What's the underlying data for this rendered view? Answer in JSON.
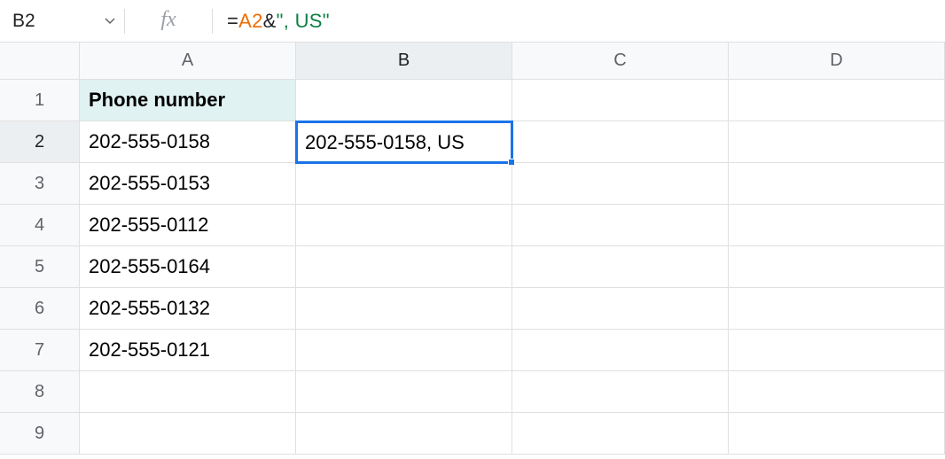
{
  "nameBox": {
    "value": "B2"
  },
  "fxLabel": "fx",
  "formula": {
    "raw": "=A2&\", US\"",
    "tokens": {
      "eq": "=",
      "ref": "A2",
      "op": "&",
      "q1": "\"",
      "str": ", US",
      "q2": "\""
    }
  },
  "columns": [
    "A",
    "B",
    "C",
    "D"
  ],
  "rowCount": 9,
  "activeCell": {
    "col": "B",
    "row": 2
  },
  "cells": {
    "A1": "Phone number",
    "A2": "202-555-0158",
    "A3": "202-555-0153",
    "A4": "202-555-0112",
    "A5": "202-555-0164",
    "A6": "202-555-0132",
    "A7": "202-555-0121",
    "B2": "202-555-0158, US"
  },
  "chart_data": {
    "type": "table",
    "title": "Phone number",
    "columns": [
      "Phone number"
    ],
    "rows": [
      [
        "202-555-0158"
      ],
      [
        "202-555-0153"
      ],
      [
        "202-555-0112"
      ],
      [
        "202-555-0164"
      ],
      [
        "202-555-0132"
      ],
      [
        "202-555-0121"
      ]
    ]
  }
}
